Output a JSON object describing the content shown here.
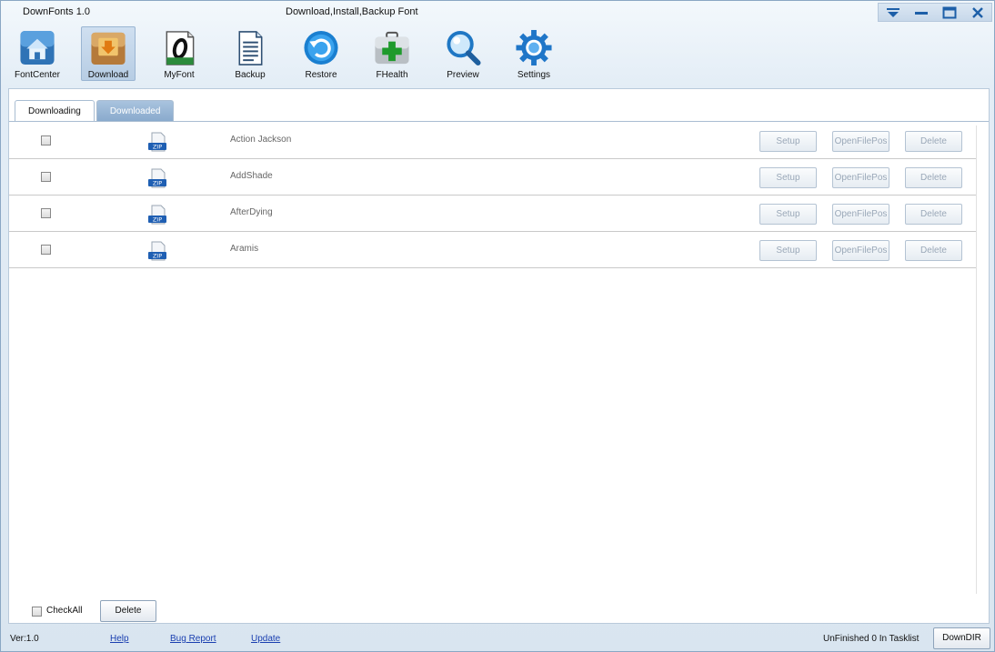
{
  "window": {
    "title": "DownFonts 1.0",
    "subtitle": "Download,Install,Backup Font"
  },
  "toolbar": {
    "items": [
      {
        "label": "FontCenter",
        "icon": "house-icon"
      },
      {
        "label": "Download",
        "icon": "download-box-icon",
        "active": true
      },
      {
        "label": "MyFont",
        "icon": "font-o-icon"
      },
      {
        "label": "Backup",
        "icon": "document-icon"
      },
      {
        "label": "Restore",
        "icon": "restore-arrow-icon"
      },
      {
        "label": "FHealth",
        "icon": "medical-kit-icon"
      },
      {
        "label": "Preview",
        "icon": "magnifier-icon"
      },
      {
        "label": "Settings",
        "icon": "gear-icon"
      }
    ]
  },
  "tabs": [
    {
      "label": "Downloading",
      "selected": false
    },
    {
      "label": "Downloaded",
      "selected": true
    }
  ],
  "fonts": [
    {
      "name": "Action Jackson",
      "type_icon": "zip-icon",
      "zip_text": "ZIP"
    },
    {
      "name": "AddShade",
      "type_icon": "zip-icon",
      "zip_text": "ZIP"
    },
    {
      "name": "AfterDying",
      "type_icon": "zip-icon",
      "zip_text": "ZIP"
    },
    {
      "name": "Aramis",
      "type_icon": "zip-icon",
      "zip_text": "ZIP"
    }
  ],
  "row_actions": {
    "setup": "Setup",
    "open_file_pos": "OpenFilePos",
    "delete": "Delete"
  },
  "bottom": {
    "checkall_label": "CheckAll",
    "delete_label": "Delete"
  },
  "statusbar": {
    "version": "Ver:1.0",
    "help": "Help",
    "bug_report": "Bug Report",
    "update": "Update",
    "status": "UnFinished 0 In Tasklist",
    "downdir": "DownDIR"
  },
  "colors": {
    "accent": "#88a9cc",
    "link": "#1a3fb0",
    "disabled_text": "#9aa8b8"
  }
}
